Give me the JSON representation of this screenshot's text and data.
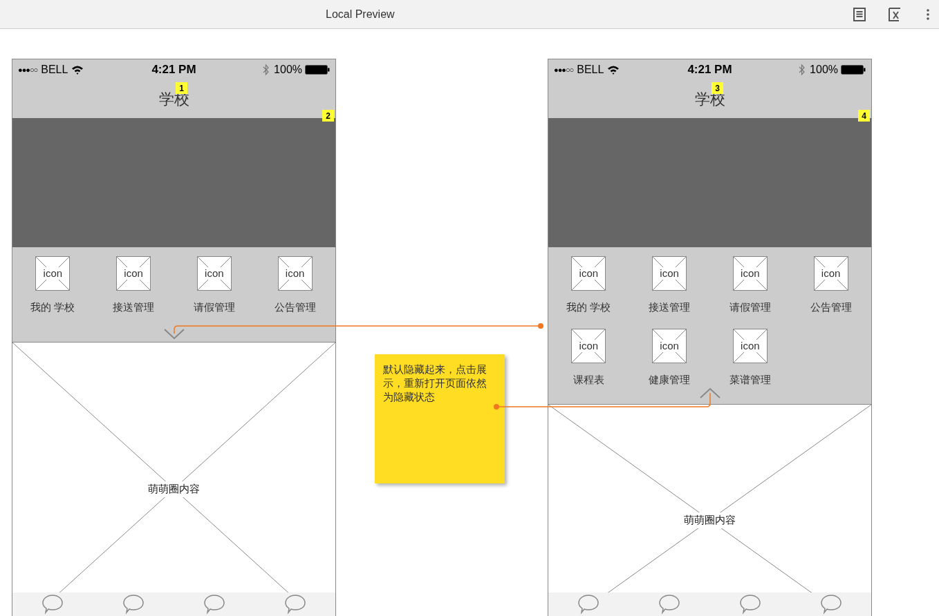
{
  "toolbar": {
    "title": "Local Preview"
  },
  "screens": [
    {
      "status": {
        "signal": "●●●○○",
        "carrier": "BELL",
        "time": "4:21 PM",
        "battery": "100%"
      },
      "title": "学校",
      "title_marker": "1",
      "banner_marker": "2",
      "menu_expanded": false,
      "menu": [
        {
          "label": "我的 学校",
          "icon_text": "icon"
        },
        {
          "label": "接送管理",
          "icon_text": "icon"
        },
        {
          "label": "请假管理",
          "icon_text": "icon"
        },
        {
          "label": "公告管理",
          "icon_text": "icon"
        }
      ],
      "content": "萌萌圈内容"
    },
    {
      "status": {
        "signal": "●●●○○",
        "carrier": "BELL",
        "time": "4:21 PM",
        "battery": "100%"
      },
      "title": "学校",
      "title_marker": "3",
      "banner_marker": "4",
      "menu_expanded": true,
      "menu": [
        {
          "label": "我的 学校",
          "icon_text": "icon"
        },
        {
          "label": "接送管理",
          "icon_text": "icon"
        },
        {
          "label": "请假管理",
          "icon_text": "icon"
        },
        {
          "label": "公告管理",
          "icon_text": "icon"
        },
        {
          "label": "课程表",
          "icon_text": "icon"
        },
        {
          "label": "健康管理",
          "icon_text": "icon"
        },
        {
          "label": "菜谱管理",
          "icon_text": "icon"
        }
      ],
      "content": "萌萌圈内容"
    }
  ],
  "note": {
    "text": "默认隐藏起来，点击展示，重新打开页面依然为隐藏状态"
  }
}
